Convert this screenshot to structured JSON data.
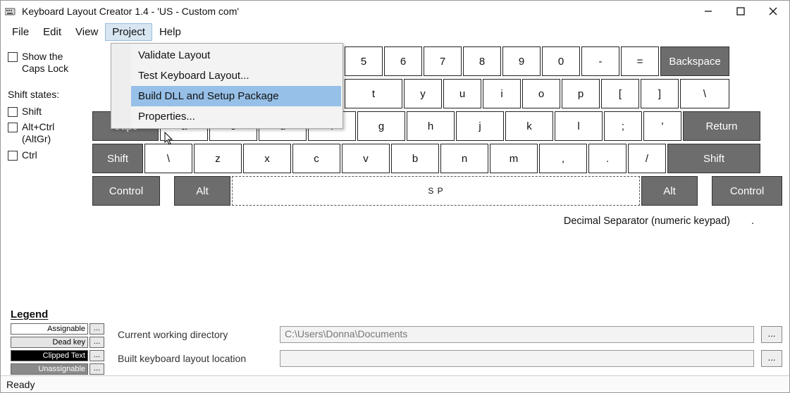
{
  "window": {
    "title": "Keyboard Layout Creator 1.4 - 'US - Custom com'"
  },
  "menu": {
    "items": [
      "File",
      "Edit",
      "View",
      "Project",
      "Help"
    ],
    "open_index": 3,
    "dropdown": [
      "Validate Layout",
      "Test Keyboard Layout...",
      "Build DLL and Setup Package",
      "Properties..."
    ],
    "selected_dropdown_index": 2
  },
  "left": {
    "show_caps": "Show the Caps Lock",
    "shift_states_label": "Shift states:",
    "states": [
      "Shift",
      "Alt+Ctrl (AltGr)",
      "Ctrl"
    ]
  },
  "keyboard": {
    "row1": [
      "5",
      "6",
      "7",
      "8",
      "9",
      "0",
      "-",
      "="
    ],
    "row1_end": "Backspace",
    "row2": [
      "t",
      "y",
      "u",
      "i",
      "o",
      "p",
      "[",
      "]",
      "\\"
    ],
    "row3_start": "Caps",
    "row3": [
      "a",
      "s",
      "d",
      "f",
      "g",
      "h",
      "j",
      "k",
      "l",
      ";",
      "'"
    ],
    "row3_end": "Return",
    "row4_start": "Shift",
    "row4": [
      "\\",
      "z",
      "x",
      "c",
      "v",
      "b",
      "n",
      "m",
      ",",
      ".",
      "/"
    ],
    "row4_end": "Shift",
    "row5": {
      "ctrl": "Control",
      "alt": "Alt",
      "space": "S P",
      "alt2": "Alt",
      "ctrl2": "Control"
    },
    "decsep": "Decimal Separator (numeric keypad)",
    "decdot": "."
  },
  "legend": {
    "title": "Legend",
    "rows": [
      "Assignable",
      "Dead key",
      "Clipped Text",
      "Unassignable"
    ],
    "btn": "..."
  },
  "dirs": {
    "cwd_label": "Current working directory",
    "cwd_value": "C:\\Users\\Donna\\Documents",
    "out_label": "Built keyboard layout location",
    "out_value": "",
    "browse": "..."
  },
  "status": "Ready"
}
